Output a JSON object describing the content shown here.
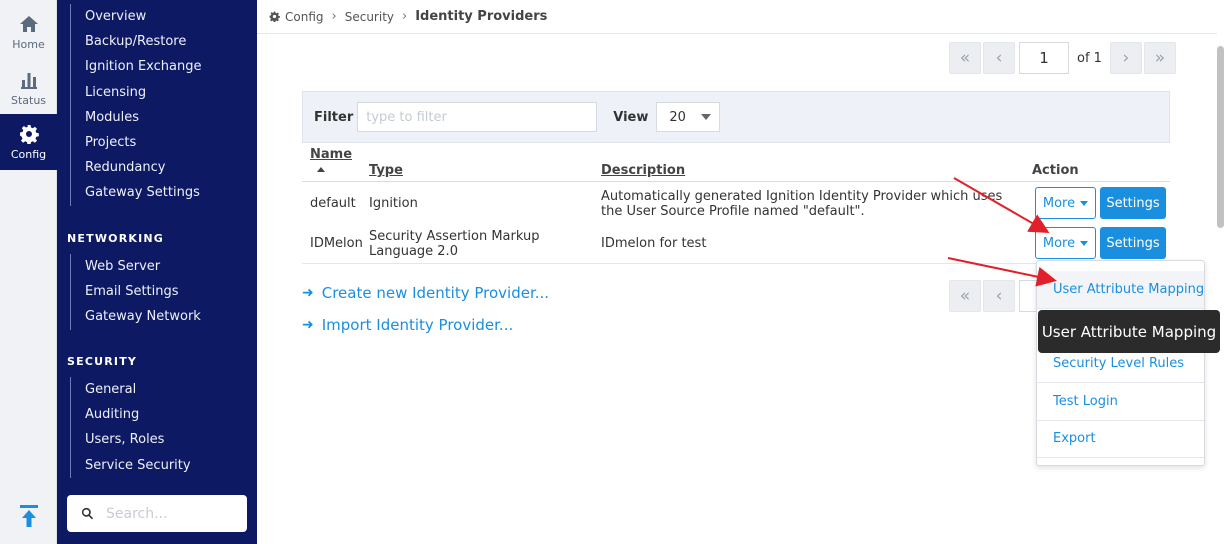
{
  "rail": {
    "home": "Home",
    "status": "Status",
    "config": "Config"
  },
  "sidebar": {
    "top_items": [
      "Overview",
      "Backup/Restore",
      "Ignition Exchange",
      "Licensing",
      "Modules",
      "Projects",
      "Redundancy",
      "Gateway Settings"
    ],
    "networking_heading": "NETWORKING",
    "networking_items": [
      "Web Server",
      "Email Settings",
      "Gateway Network"
    ],
    "security_heading": "SECURITY",
    "security_items": [
      "General",
      "Auditing",
      "Users, Roles",
      "Service Security"
    ],
    "search_placeholder": "Search..."
  },
  "breadcrumb": {
    "config": "Config",
    "security": "Security",
    "current": "Identity Providers"
  },
  "pager": {
    "page": "1",
    "of_label": "of 1"
  },
  "filter": {
    "label": "Filter",
    "placeholder": "type to filter",
    "view_label": "View",
    "view_value": "20"
  },
  "table": {
    "headers": {
      "name": "Name",
      "type": "Type",
      "description": "Description",
      "action": "Action"
    },
    "rows": [
      {
        "name": "default",
        "type": "Ignition",
        "description": "Automatically generated Ignition Identity Provider which uses the User Source Profile named \"default\".",
        "more": "More",
        "settings": "Settings"
      },
      {
        "name": "IDMelon",
        "type": "Security Assertion Markup Language 2.0",
        "description": "IDmelon for test",
        "more": "More",
        "settings": "Settings"
      }
    ]
  },
  "links": {
    "create": "Create new Identity Provider...",
    "import": "Import Identity Provider..."
  },
  "dropdown": {
    "items": [
      "User Attribute Mapping",
      "Security Level Rules",
      "Test Login",
      "Export"
    ]
  },
  "tooltip": "User Attribute Mapping",
  "colors": {
    "sidebar_bg": "#0d1a63",
    "accent": "#1a8fe0",
    "annotation_arrow": "#e0202a"
  }
}
